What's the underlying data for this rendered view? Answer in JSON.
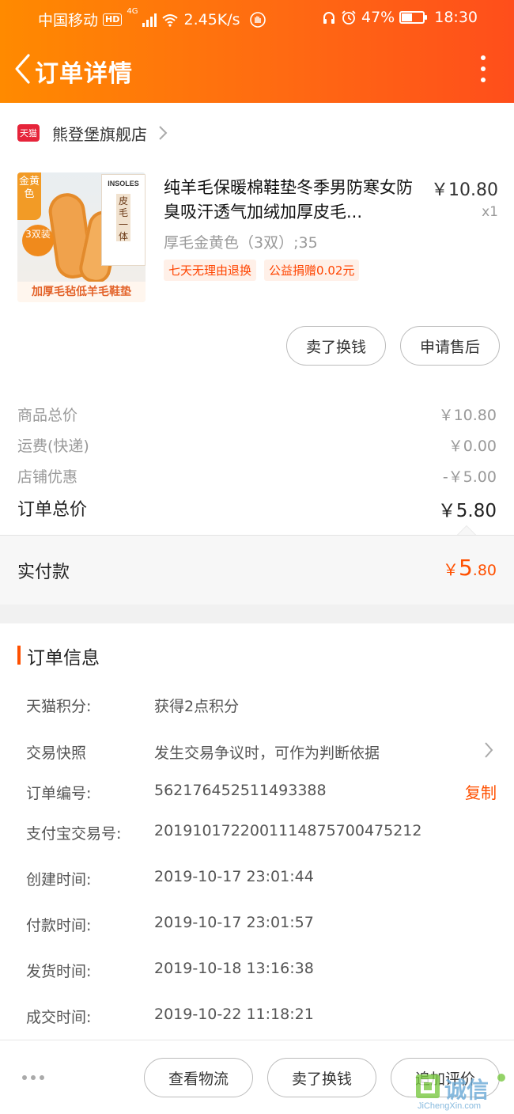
{
  "status_bar": {
    "carrier": "中国移动",
    "hd": "HD",
    "network": "4G",
    "speed": "2.45K/s",
    "battery_percent": "47%",
    "battery_level": 0.47,
    "time": "18:30",
    "icons": [
      "signal-icon",
      "wifi-icon",
      "hand-icon",
      "headphones-icon",
      "alarm-icon",
      "battery-icon"
    ]
  },
  "header": {
    "title": "订单详情",
    "back_icon": "chevron-left-icon",
    "more_icon": "more-vertical-icon"
  },
  "shop": {
    "badge": "天猫",
    "name": "熊登堡旗舰店"
  },
  "product": {
    "image_badge": "金黄色",
    "image_count_badge": "3双装",
    "image_brand": "INSOLES",
    "image_box_text": "皮毛一体",
    "image_caption": "加厚毛毡低羊毛鞋垫",
    "title": "纯羊毛保暖棉鞋垫冬季男防寒女防臭吸汗透气加绒加厚皮毛...",
    "price": "￥10.80",
    "quantity": "x1",
    "sku": "厚毛金黄色（3双）;35",
    "tags": [
      "七天无理由退换",
      "公益捐赠0.02元"
    ]
  },
  "item_actions": {
    "sell_label": "卖了换钱",
    "after_sale_label": "申请售后"
  },
  "price_summary": {
    "lines": [
      {
        "label": "商品总价",
        "value": "￥10.80"
      },
      {
        "label": "运费(快递)",
        "value": "￥0.00"
      },
      {
        "label": "店铺优惠",
        "value": "-￥5.00"
      }
    ],
    "total_label": "订单总价",
    "total_value": "￥5.80",
    "paid_label": "实付款",
    "paid_currency": "￥",
    "paid_int": "5",
    "paid_dec": ".80"
  },
  "order_info": {
    "title": "订单信息",
    "rows": [
      {
        "label": "天猫积分:",
        "value": "获得2点积分"
      },
      {
        "label": "交易快照",
        "value": "发生交易争议时，可作为判断依据"
      },
      {
        "label": "订单编号:",
        "value": "562176452511493388",
        "action": "复制"
      },
      {
        "label": "支付宝交易号:",
        "value": "2019101722001114875700475212"
      },
      {
        "label": "创建时间:",
        "value": "2019-10-17 23:01:44"
      },
      {
        "label": "付款时间:",
        "value": "2019-10-17 23:01:57"
      },
      {
        "label": "发货时间:",
        "value": "2019-10-18 13:16:38"
      },
      {
        "label": "成交时间:",
        "value": "2019-10-22 11:18:21"
      }
    ]
  },
  "bottom_bar": {
    "more_icon": "more-horizontal-icon",
    "logistics_label": "查看物流",
    "sell_label": "卖了换钱",
    "review_label": "追加评价"
  },
  "watermark": {
    "name": "诚信",
    "url": "JiChengXin.com"
  },
  "colors": {
    "accent": "#ff5000",
    "header_start": "#ff8a00",
    "header_end": "#ff4e1b",
    "tmall_red": "#e6243a"
  }
}
